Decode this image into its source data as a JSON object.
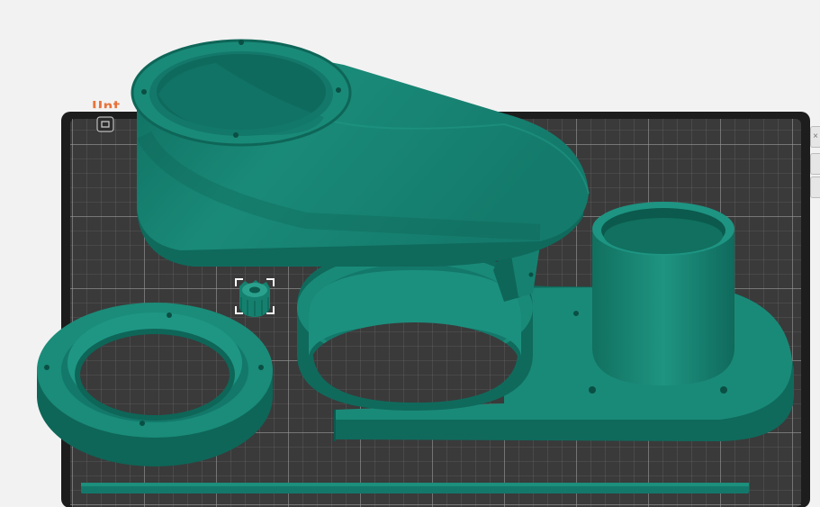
{
  "plate": {
    "name_fragment": "Unt",
    "plate_icon": "plate-type-icon",
    "colors": {
      "bed": "#3a3a3a",
      "grid": "#8a8a8a",
      "frame": "#1d1d1d"
    }
  },
  "side_panel": {
    "close_glyph": "×",
    "close_icon": "close-icon"
  },
  "model": {
    "color": "#16806f",
    "parts": [
      "dust-hood-body",
      "clamp-ring",
      "base-plate-with-port",
      "small-gear",
      "long-strip"
    ],
    "selected_part": "small-gear"
  }
}
